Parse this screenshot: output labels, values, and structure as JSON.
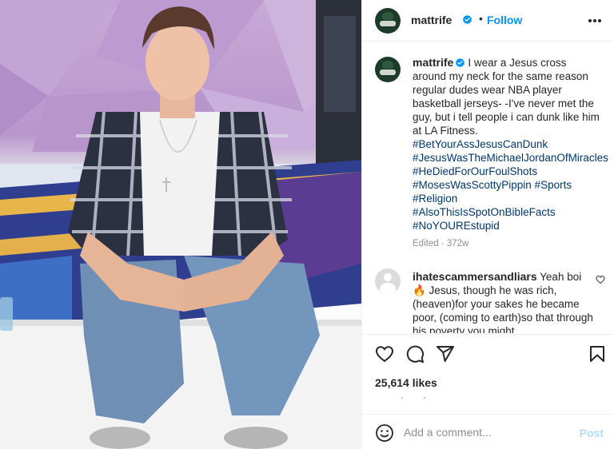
{
  "header": {
    "username": "mattrife",
    "separator": "•",
    "follow_label": "Follow"
  },
  "caption": {
    "username": "mattrife",
    "text": "I wear a Jesus cross around my neck for the same reason regular dudes wear NBA player basketball jerseys- -I've never met the guy, but i tell people i can dunk like him at LA Fitness.",
    "hashtags": [
      "#BetYourAssJesusCanDunk",
      "#JesusWasTheMichaelJordanOfMiracles #HeDiedForOurFoulShots",
      "#MosesWasScottyPippin #Sports",
      "#Religion",
      "#AlsoThisIsSpotOnBibleFacts",
      "#NoYOUREstupid"
    ],
    "meta": "Edited · 372w"
  },
  "comment": {
    "username": "ihatescammersandliars",
    "text": "Yeah boi 🔥 Jesus, though he was rich, (heaven)for your sakes he became poor, (coming to earth)so that through his poverty you might"
  },
  "actions": {
    "likes": "25,614 likes"
  },
  "add_comment": {
    "placeholder": "Add a comment...",
    "post_label": "Post"
  },
  "colors": {
    "accent": "#0095f6",
    "hashtag": "#00376b",
    "muted": "#8e8e8e",
    "post_disabled": "#b3dbff",
    "verified": "#0095f6"
  },
  "icons": [
    "verified-badge-icon",
    "more-options-icon",
    "heart-icon",
    "comment-icon",
    "share-icon",
    "bookmark-icon",
    "emoji-icon"
  ]
}
